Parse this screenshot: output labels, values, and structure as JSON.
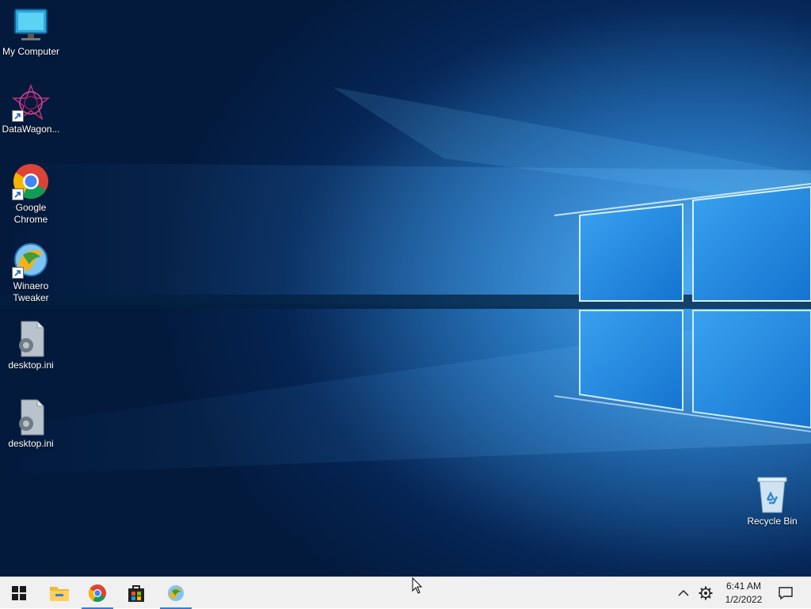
{
  "desktop": {
    "icons": [
      {
        "label": "My Computer",
        "icon": "computer-icon"
      },
      {
        "label": "DataWagon...",
        "icon": "datawagon-icon",
        "shortcut": true
      },
      {
        "label": "Google Chrome",
        "icon": "chrome-icon",
        "shortcut": true
      },
      {
        "label": "Winaero Tweaker",
        "icon": "winaero-tweaker-icon",
        "shortcut": true
      },
      {
        "label": "desktop.ini",
        "icon": "settings-file-icon"
      },
      {
        "label": "desktop.ini",
        "icon": "settings-file-icon"
      }
    ],
    "recycle_bin": {
      "label": "Recycle Bin",
      "icon": "recycle-bin-icon"
    }
  },
  "taskbar": {
    "start": {
      "icon": "windows-start-icon"
    },
    "pinned": [
      {
        "icon": "file-explorer-icon",
        "active": false
      },
      {
        "icon": "chrome-icon",
        "active": true
      },
      {
        "icon": "microsoft-store-icon",
        "active": false
      },
      {
        "icon": "winaero-tweaker-icon",
        "active": true
      }
    ],
    "tray": {
      "overflow_icon": "chevron-up-icon",
      "settings_icon": "gear-icon",
      "time": "6:41 AM",
      "date": "1/2/2022",
      "notification_icon": "action-center-icon"
    }
  },
  "colors": {
    "wallpaper_dark": "#031a3d",
    "wallpaper_light": "#1b7fd6",
    "taskbar_bg": "#f0f0f0",
    "active_indicator": "#3a7bd5"
  }
}
